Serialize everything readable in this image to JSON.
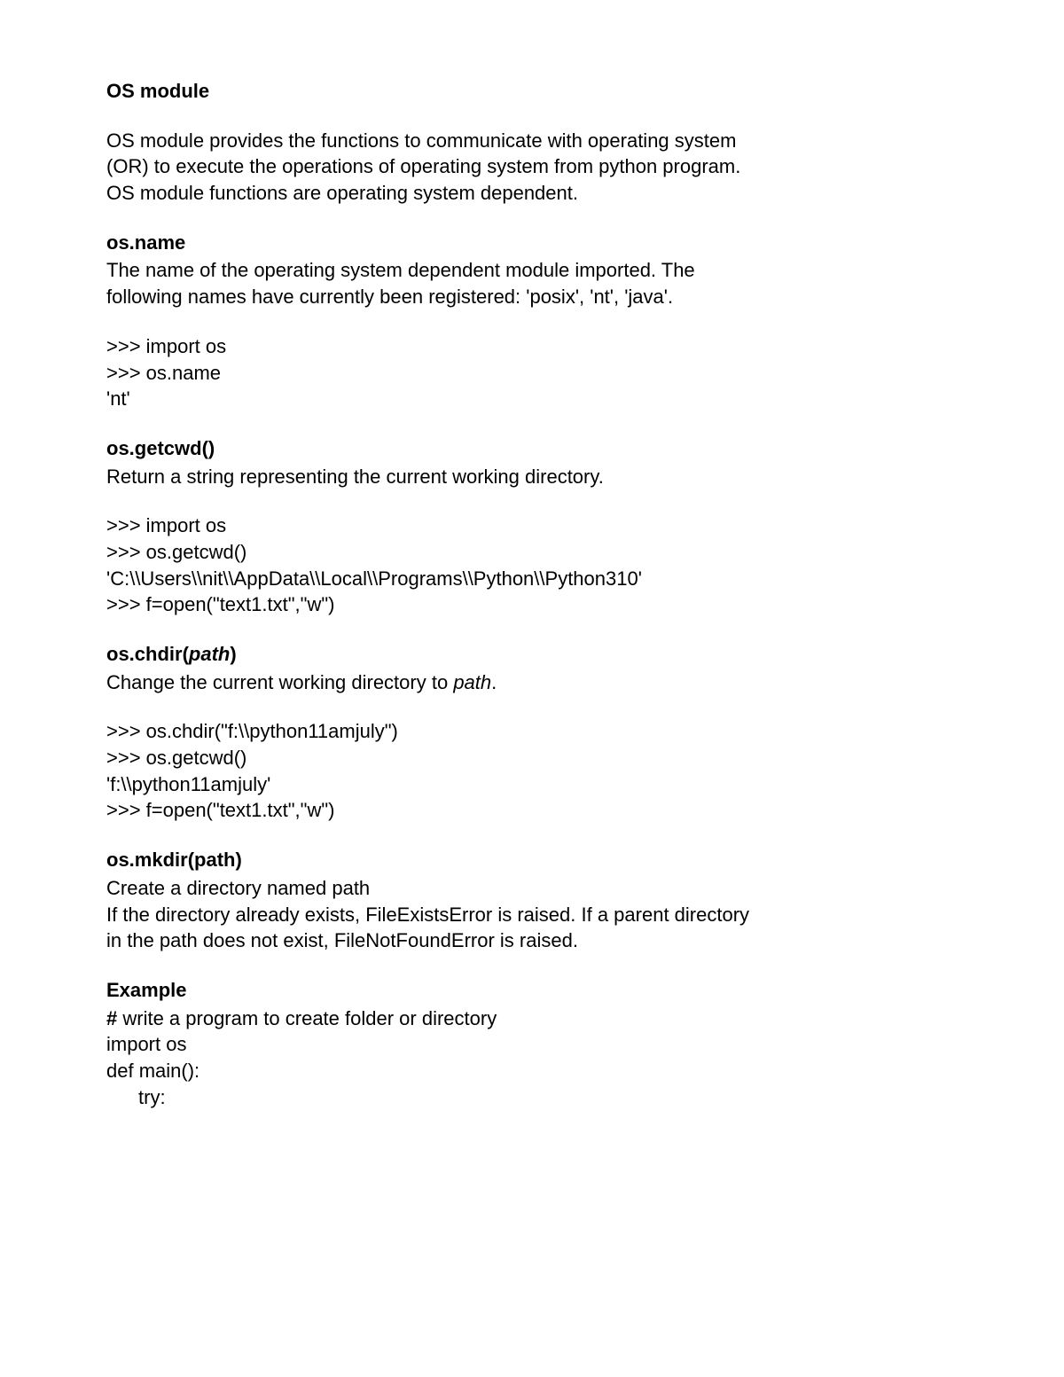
{
  "title": "OS module",
  "intro": {
    "l1": "OS module provides the functions to communicate with operating system",
    "l2": "(OR) to execute the operations of operating system from python program.",
    "l3": "OS module functions are operating system dependent."
  },
  "osname": {
    "heading": "os.name",
    "desc1": "The name of the operating system dependent module imported. The",
    "desc2": "following names have currently been registered: 'posix', 'nt', 'java'.",
    "code": {
      "l1": ">>> import os",
      "l2": ">>> os.name",
      "l3": "'nt'"
    }
  },
  "getcwd": {
    "heading": "os.getcwd()",
    "desc": "Return a string representing the current working directory.",
    "code": {
      "l1": ">>> import os",
      "l2": ">>> os.getcwd()",
      "l3": "'C:\\\\Users\\\\nit\\\\AppData\\\\Local\\\\Programs\\\\Python\\\\Python310'",
      "l4": ">>> f=open(\"text1.txt\",\"w\")"
    }
  },
  "chdir": {
    "heading_pre": "os.chdir(",
    "heading_arg": "path",
    "heading_post": ")",
    "desc_pre": "Change the current working directory to ",
    "desc_arg": "path",
    "desc_post": ".",
    "code": {
      "l1": ">>> os.chdir(\"f:\\\\python11amjuly\")",
      "l2": ">>> os.getcwd()",
      "l3": "'f:\\\\python11amjuly'",
      "l4": ">>> f=open(\"text1.txt\",\"w\")"
    }
  },
  "mkdir": {
    "heading": "os.mkdir(path)",
    "desc1": "Create a directory named path",
    "desc2": "If the directory already exists, FileExistsError is raised. If a parent directory",
    "desc3": "in the path does not exist, FileNotFoundError is raised."
  },
  "example": {
    "heading": "Example",
    "comment_hash": "# ",
    "comment_text": "write a program to create folder or directory",
    "l2": "import os",
    "l3": "def main():",
    "l4": "try:"
  }
}
